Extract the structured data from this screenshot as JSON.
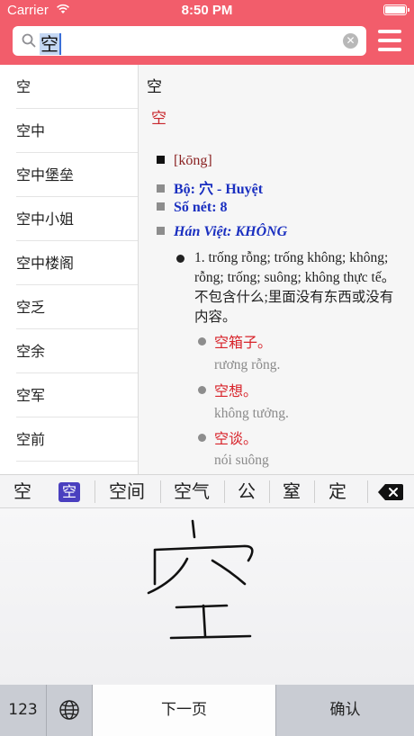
{
  "status_bar": {
    "carrier": "Carrier",
    "time": "8:50 PM"
  },
  "search": {
    "query": "空"
  },
  "word_list": [
    "空",
    "空中",
    "空中堡垒",
    "空中小姐",
    "空中楼阁",
    "空乏",
    "空余",
    "空军",
    "空前"
  ],
  "definition": {
    "headword": "空",
    "headword_red": "空",
    "pinyin": "[kōng]",
    "radical": "Bộ: 穴 - Huyệt",
    "strokes": "Số nét: 8",
    "han_viet": "Hán Việt: KHÔNG",
    "meaning": "1. trống rỗng; trống không; không; rỗng; trống; suông; không thực tế。不包含什么;里面没有东西或没有内容。",
    "examples": [
      {
        "word": "空箱子。",
        "translation": "rương rỗng."
      },
      {
        "word": "空想。",
        "translation": "không tưởng."
      },
      {
        "word": "空谈。",
        "translation": "nói suông"
      }
    ]
  },
  "candidates": {
    "first": "空",
    "badge": "空",
    "items": [
      "空间",
      "空气",
      "公",
      "窒",
      "定"
    ]
  },
  "keyboard": {
    "numbers": "123",
    "next_page": "下一页",
    "confirm": "确认"
  },
  "colors": {
    "header": "#f25d6b",
    "accent_red": "#d8232a",
    "link_blue": "#1a2fc0"
  },
  "icons": [
    "wifi-icon",
    "battery-icon",
    "search-icon",
    "clear-icon",
    "menu-icon",
    "backspace-icon",
    "globe-icon"
  ]
}
